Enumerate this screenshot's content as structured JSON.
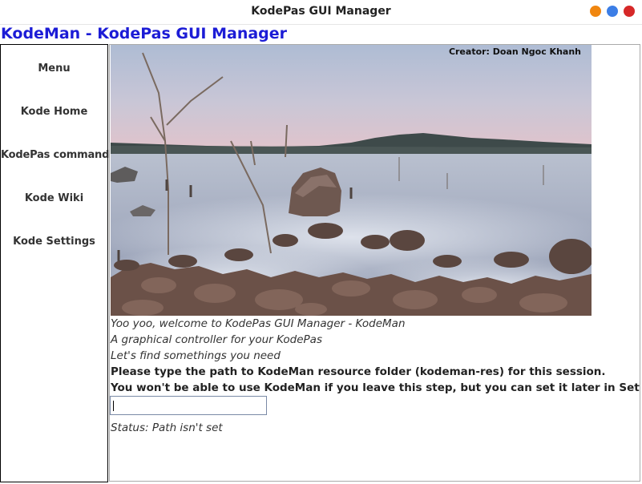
{
  "window": {
    "title": "KodePas GUI Manager",
    "buttons": [
      {
        "name": "minimize",
        "color": "#f0860f"
      },
      {
        "name": "maximize",
        "color": "#3c7ee6"
      },
      {
        "name": "close",
        "color": "#d62828"
      }
    ]
  },
  "app": {
    "heading": "KodeMan - KodePas GUI Manager",
    "heading_color": "#1c1cd6"
  },
  "sidebar": {
    "items": [
      {
        "label": "Menu"
      },
      {
        "label": "Kode Home"
      },
      {
        "label": "KodePas command"
      },
      {
        "label": "Kode Wiki"
      },
      {
        "label": "Kode Settings"
      }
    ]
  },
  "main": {
    "banner": {
      "credit": "Creator: Doan Ngoc Khanh"
    },
    "welcome": "Yoo yoo, welcome to KodePas GUI Manager - KodeMan",
    "subtitle": "A graphical controller for your KodePas",
    "hint": "Let's find somethings you need",
    "instruction": "Please type the path to KodeMan resource folder (kodeman-res) for this session.",
    "warning": "You won't be able to use KodeMan if you leave this step, but you can set it later in Settings",
    "path_input": {
      "value": "",
      "placeholder": ""
    },
    "status": "Status: Path isn't set"
  }
}
